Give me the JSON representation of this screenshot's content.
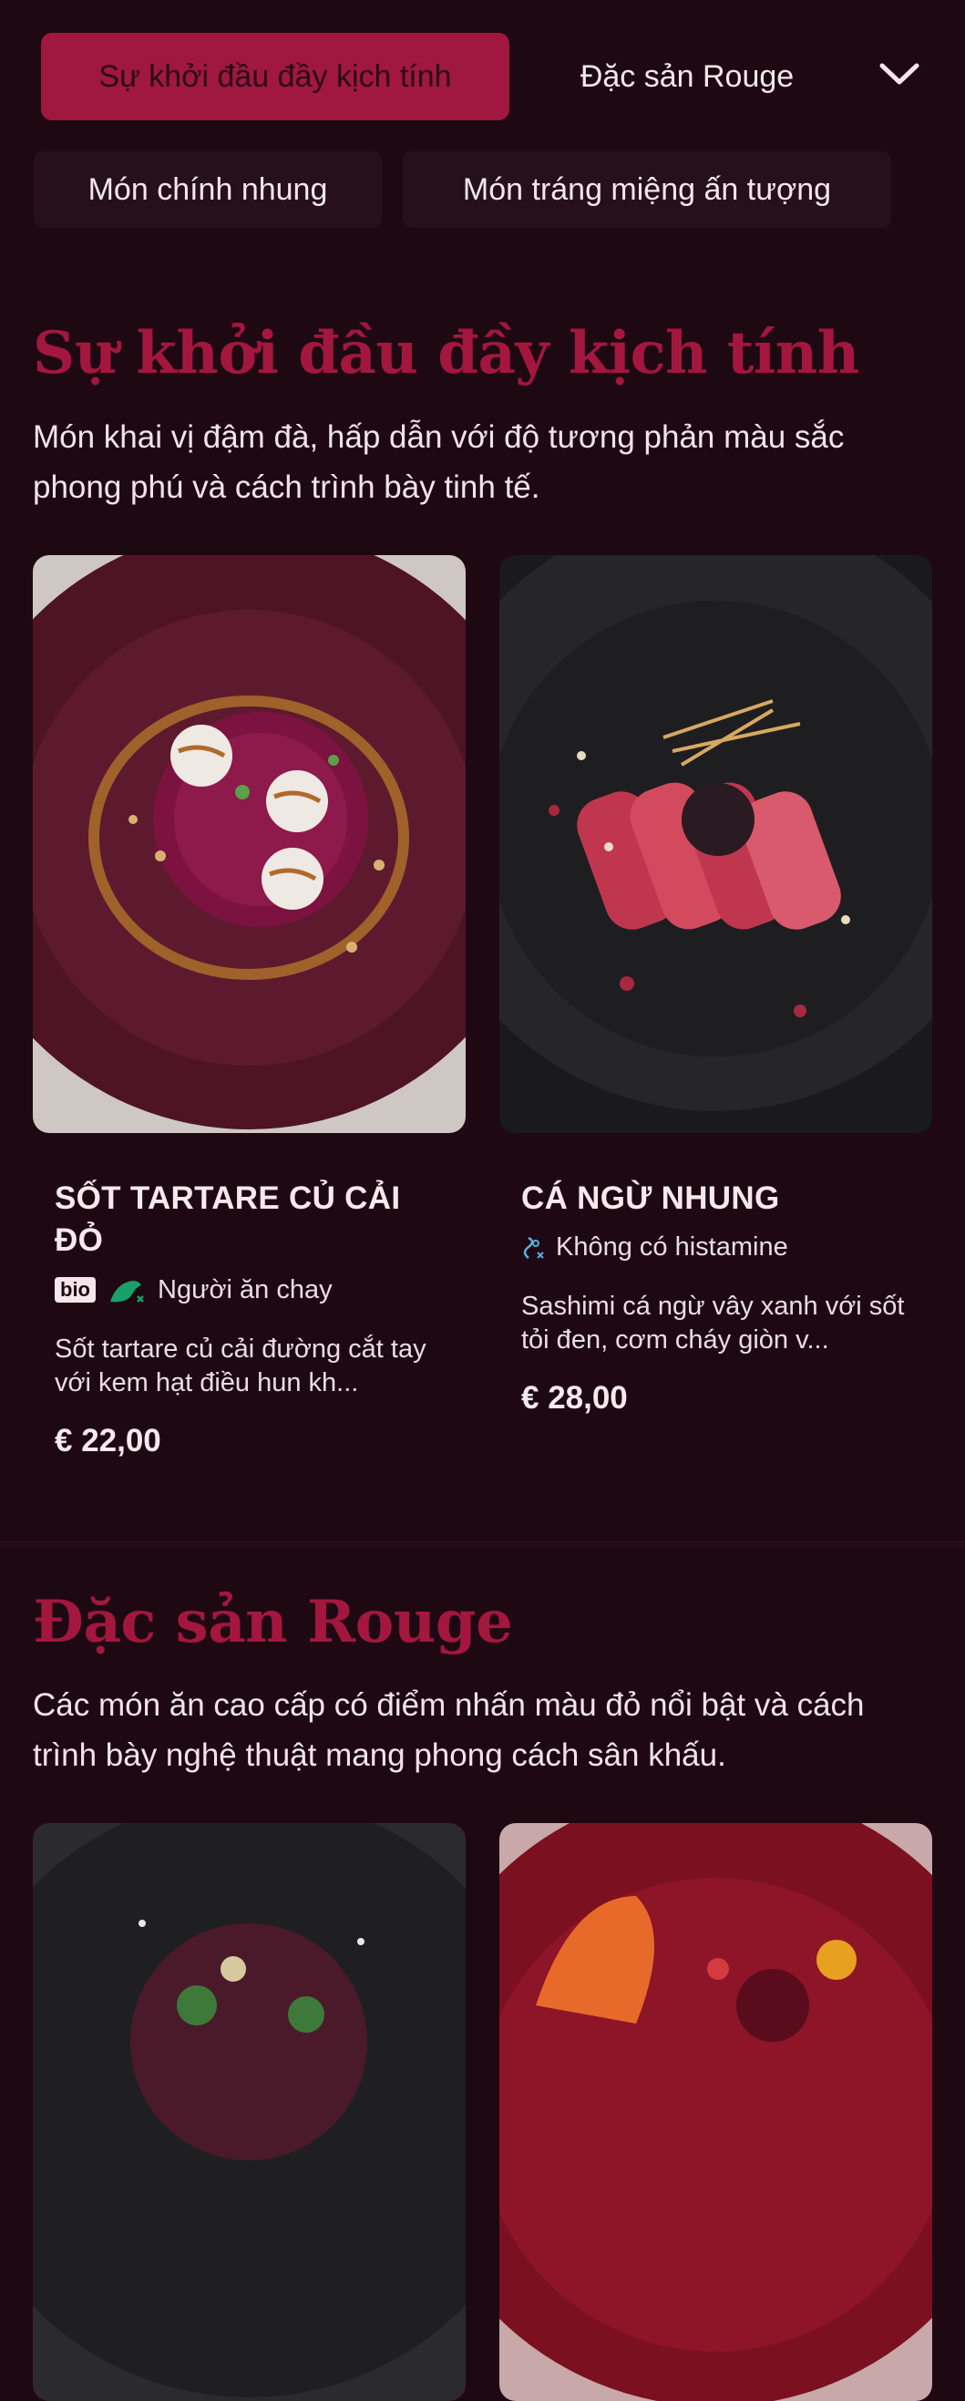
{
  "nav": {
    "tabs": [
      {
        "label": "Sự khởi đầu đầy kịch tính",
        "active": true
      },
      {
        "label": "Đặc sản Rouge",
        "active": false
      },
      {
        "label": "Món chính nhung",
        "active": false
      },
      {
        "label": "Món tráng miệng ấn tượng",
        "active": false
      }
    ],
    "expand_icon": "chevron-down-icon"
  },
  "sections": [
    {
      "title": "Sự khởi đầu đầy kịch tính",
      "description": "Món khai vị đậm đà, hấp dẫn với độ tương phản màu sắc phong phú và cách trình bày tinh tế.",
      "items": [
        {
          "name": "SỐT TARTARE CỦ CẢI ĐỎ",
          "badge": "bio",
          "tag_icon": "vegetarian-icon",
          "tag": "Người ăn chay",
          "description": "Sốt tartare củ cải đường cắt tay với kem hạt điều hun kh...",
          "price": "€ 22,00"
        },
        {
          "name": "CÁ NGỪ NHUNG",
          "tag_icon": "histamine-free-icon",
          "tag": "Không có histamine",
          "description": "Sashimi cá ngừ vây xanh với sốt tỏi đen, cơm cháy giòn v...",
          "price": "€ 28,00"
        }
      ]
    },
    {
      "title": "Đặc sản Rouge",
      "description": "Các món ăn cao cấp có điểm nhấn màu đỏ nổi bật và cách trình bày nghệ thuật mang phong cách sân khấu."
    }
  ],
  "colors": {
    "background": "#1e0912",
    "accent": "#a3173f",
    "tab_background": "#26101a"
  }
}
